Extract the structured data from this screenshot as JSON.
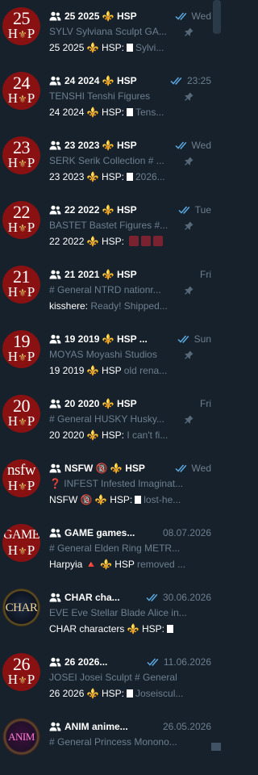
{
  "chats": [
    {
      "avatar_top": "25",
      "avatar_bot": "HSP",
      "title": "25 2025 ⚜️ HSP",
      "time": "Wed",
      "read": true,
      "line2": [
        {
          "t": "SYLV Sylviana Sculpt  GA..."
        }
      ],
      "preview_name": "25 2025 ⚜️ HSP:",
      "preview_rest": "Sylvi...",
      "doc": true,
      "pinned": true
    },
    {
      "avatar_top": "24",
      "avatar_bot": "HSP",
      "title": "24 2024 ⚜️ HSP",
      "time": "23:25",
      "read": true,
      "line2": [
        {
          "t": "TENSHI Tenshi Figures"
        }
      ],
      "preview_name": "24 2024 ⚜️ HSP:",
      "preview_rest": "Tens...",
      "doc": true,
      "pinned": true
    },
    {
      "avatar_top": "23",
      "avatar_bot": "HSP",
      "title": "23 2023 ⚜️ HSP",
      "time": "Wed",
      "read": true,
      "line2": [
        {
          "t": "SERK Serik Collection  # ..."
        }
      ],
      "preview_name": "23 2023 ⚜️ HSP:",
      "preview_rest": "2026...",
      "doc": true,
      "pinned": true
    },
    {
      "avatar_top": "22",
      "avatar_bot": "HSP",
      "title": "22 2022 ⚜️ HSP",
      "time": "Tue",
      "read": true,
      "line2": [
        {
          "t": "BASTET Bastet Figures  #..."
        }
      ],
      "preview_name": "22 2022 ⚜️ HSP:",
      "preview_rest": "",
      "doc": false,
      "thumbs": 3,
      "pinned": true
    },
    {
      "avatar_top": "21",
      "avatar_bot": "HSP",
      "title": "21 2021 ⚜️ HSP",
      "time": "Fri",
      "read": false,
      "line2": [
        {
          "t": "# General   NTRD nationr..."
        }
      ],
      "preview_name": "kisshere:",
      "preview_rest": "Ready! Shipped...",
      "doc": false,
      "pinned": true
    },
    {
      "avatar_top": "19",
      "avatar_bot": "HSP",
      "title": "19 2019 ⚜️ HSP ...",
      "time": "Sun",
      "read": true,
      "line2": [
        {
          "t": "MOYAS Moyashi Studios"
        }
      ],
      "preview_name": "19 2019 ⚜️ HSP",
      "preview_rest": "old rena...",
      "doc": false,
      "pinned": true
    },
    {
      "avatar_top": "20",
      "avatar_bot": "HSP",
      "title": "20 2020 ⚜️ HSP",
      "time": "Fri",
      "read": false,
      "line2": [
        {
          "t": "# General   HUSKY Husky..."
        }
      ],
      "preview_name": "20 2020 ⚜️ HSP:",
      "preview_rest": "I can't fi...",
      "doc": false,
      "pinned": true
    },
    {
      "avatar_top": "nsfw",
      "avatar_bot": "HSP",
      "title": "NSFW 🔞 ⚜️ HSP",
      "time": "Wed",
      "read": true,
      "line2": [
        {
          "t": "❓ INFEST Infested Imaginat..."
        }
      ],
      "preview_name": "NSFW 🔞 ⚜️ HSP:",
      "preview_rest": "lost-he...",
      "doc": true,
      "pinned": false
    },
    {
      "avatar_top": "GAME",
      "avatar_bot": "HSP",
      "title": "GAME games...",
      "time": "08.07.2026",
      "read": false,
      "line2": [
        {
          "t": "# General   Elden Ring   METR..."
        }
      ],
      "preview_name": "Harpyia 🔺 ⚜️ HSP",
      "preview_rest": "removed ...",
      "doc": false,
      "pinned": false
    },
    {
      "avatar_top": "CHAR",
      "avatar_bot": "",
      "title": "CHAR cha...",
      "time": "30.06.2026",
      "read": true,
      "line2": [
        {
          "t": "EVE Eve Stellar Blade   Alice in..."
        }
      ],
      "preview_name": "CHAR characters ⚜️ HSP:",
      "preview_rest": "",
      "doc": true,
      "pinned": false
    },
    {
      "avatar_top": "26",
      "avatar_bot": "HSP",
      "title": "26 2026...",
      "time": "11.06.2026",
      "read": true,
      "line2": [
        {
          "t": "JOSEI Josei Sculpt   # General"
        }
      ],
      "preview_name": "26 2026 ⚜️ HSP:",
      "preview_rest": "Joseiscul...",
      "doc": true,
      "pinned": false
    },
    {
      "avatar_top": "ANIM",
      "avatar_bot": "",
      "title": "ANIM anime...",
      "time": "26.05.2026",
      "read": false,
      "line2": [
        {
          "t": "# General   Princess Monono..."
        }
      ],
      "preview_name": "",
      "preview_rest": "",
      "doc": false,
      "pinned": false
    }
  ]
}
